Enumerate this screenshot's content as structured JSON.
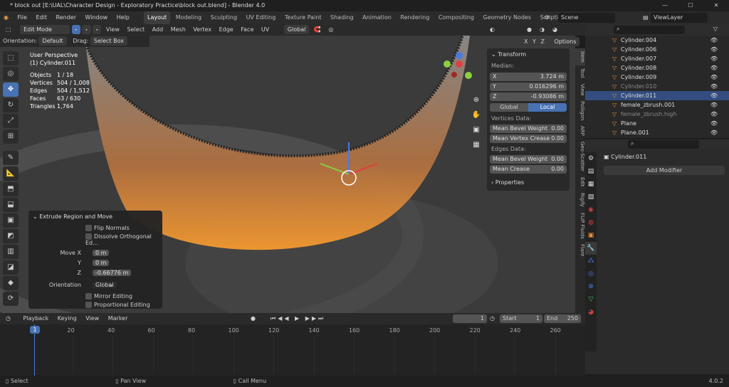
{
  "title": "* block out [E:\\UAL\\Character Design - Exploratory Practice\\block out.blend] - Blender 4.0",
  "menu": [
    "File",
    "Edit",
    "Render",
    "Window",
    "Help"
  ],
  "workspaces": [
    "Layout",
    "Modeling",
    "Sculpting",
    "UV Editing",
    "Texture Paint",
    "Shading",
    "Animation",
    "Rendering",
    "Compositing",
    "Geometry Nodes",
    "Scripting"
  ],
  "scene": "Scene",
  "view_layer": "ViewLayer",
  "header": {
    "mode": "Edit Mode",
    "menus": [
      "View",
      "Select",
      "Add",
      "Mesh",
      "Vertex",
      "Edge",
      "Face",
      "UV"
    ],
    "orientation_global": "Global",
    "options": "Options"
  },
  "header2": {
    "orientation_label": "Orientation:",
    "orientation": "Default",
    "drag_label": "Drag:",
    "drag": "Select Box"
  },
  "stats": {
    "view": "User Perspective",
    "object": "(1) Cylinder.011",
    "rows": [
      {
        "k": "Objects",
        "v": "1 / 18"
      },
      {
        "k": "Vertices",
        "v": "504 / 1,008"
      },
      {
        "k": "Edges",
        "v": "504 / 1,512"
      },
      {
        "k": "Faces",
        "v": "63 / 630"
      },
      {
        "k": "Triangles",
        "v": "1,764"
      }
    ]
  },
  "npanel": {
    "transform": "Transform",
    "median": "Median:",
    "x_label": "X",
    "x": "3.724 m",
    "y_label": "Y",
    "y": "0.016296 m",
    "z_label": "Z",
    "z": "-0.93086 m",
    "global": "Global",
    "local": "Local",
    "vertices_data": "Vertices Data:",
    "mean_bevel_weight": "Mean Bevel Weight",
    "mbw_v": "0.00",
    "mean_vertex_crease": "Mean Vertex Crease",
    "mvc_v": "0.00",
    "edges_data": "Edges Data:",
    "mean_bevel_weight_e": "Mean Bevel Weight",
    "mbwe_v": "0.00",
    "mean_crease": "Mean Crease",
    "mc_v": "0.00",
    "properties": "Properties"
  },
  "side_tabs": [
    "Item",
    "Tool",
    "View",
    "Poliigon",
    "ARP",
    "Geo-Scatter",
    "Edit",
    "Rigify",
    "FLIP Fluids",
    "Flare"
  ],
  "outliner": [
    {
      "name": "Cylinder.004",
      "sel": false
    },
    {
      "name": "Cylinder.006",
      "sel": false
    },
    {
      "name": "Cylinder.007",
      "sel": false
    },
    {
      "name": "Cylinder.008",
      "sel": false
    },
    {
      "name": "Cylinder.009",
      "sel": false
    },
    {
      "name": "Cylinder.010",
      "sel": false
    },
    {
      "name": "Cylinder.011",
      "sel": true
    },
    {
      "name": "female_zbrush.001",
      "sel": false
    },
    {
      "name": "female_zbrush.high",
      "sel": false
    },
    {
      "name": "Plane",
      "sel": false
    },
    {
      "name": "Plane.001",
      "sel": false
    }
  ],
  "props": {
    "object": "Cylinder.011",
    "add_modifier": "Add Modifier"
  },
  "operator": {
    "title": "Extrude Region and Move",
    "flip_normals": "Flip Normals",
    "dissolve": "Dissolve Orthogonal Ed...",
    "move_x_label": "Move X",
    "move_x": "0 m",
    "y_label": "Y",
    "y": "0 m",
    "z_label": "Z",
    "z": "-0.66776 m",
    "orientation_label": "Orientation",
    "orientation": "Global",
    "mirror": "Mirror Editing",
    "proportional": "Proportional Editing"
  },
  "timeline": {
    "menus": [
      "Playback",
      "Keying",
      "View",
      "Marker"
    ],
    "current": "1",
    "start_label": "Start",
    "start": "1",
    "end_label": "End",
    "end": "250",
    "ticks": [
      "1",
      "20",
      "40",
      "60",
      "80",
      "100",
      "120",
      "140",
      "160",
      "180",
      "200",
      "220",
      "240",
      "260"
    ]
  },
  "status": {
    "select": "Select",
    "pan": "Pan View",
    "call_menu": "Call Menu",
    "version": "4.0.2"
  }
}
